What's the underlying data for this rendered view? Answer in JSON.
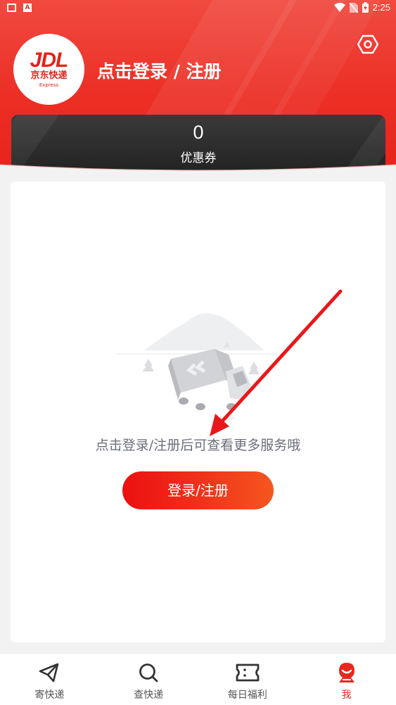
{
  "status_bar": {
    "time": "2:25"
  },
  "header": {
    "logo": {
      "brand": "JDL",
      "name_cn": "京东快递",
      "name_en": "Express"
    },
    "login_title": "点击登录 / 注册",
    "settings_icon": "settings-hex-icon"
  },
  "coupon": {
    "count": "0",
    "label": "优惠券"
  },
  "main": {
    "hint": "点击登录/注册后可查看更多服务哦",
    "login_button": "登录/注册"
  },
  "bottom_nav": {
    "items": [
      {
        "label": "寄快递",
        "icon": "send-icon",
        "active": false
      },
      {
        "label": "查快递",
        "icon": "search-icon",
        "active": false
      },
      {
        "label": "每日福利",
        "icon": "ticket-icon",
        "active": false
      },
      {
        "label": "我",
        "icon": "profile-icon",
        "active": true
      }
    ]
  },
  "colors": {
    "brand_red": "#e8281f",
    "dark_card": "#2a2a2a",
    "hint_gray": "#6b6f7a"
  }
}
